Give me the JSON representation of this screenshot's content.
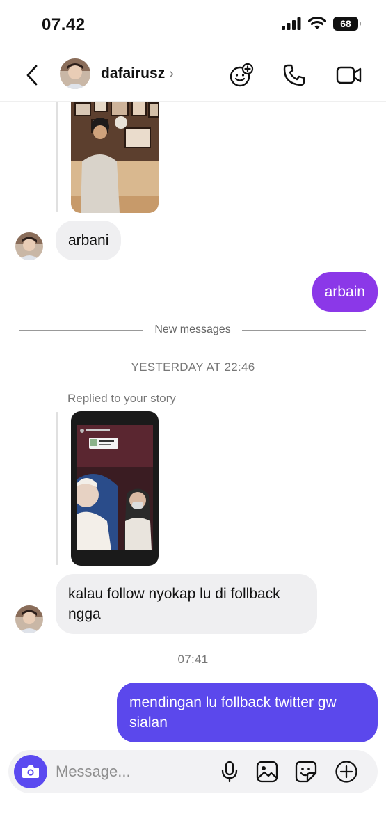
{
  "status_bar": {
    "time": "07.42",
    "battery": "68"
  },
  "header": {
    "username": "dafairusz",
    "chevron": "›"
  },
  "messages": {
    "m1": {
      "text": "arbani"
    },
    "m2": {
      "text": "arbain",
      "color": "#8b38e8"
    },
    "new_messages_label": "New messages",
    "timestamp1": "YESTERDAY AT 22:46",
    "replied_label": "Replied to your story",
    "m3": {
      "text_line1": "kalau follow nyokap lu di follback",
      "text_line2": "ngga"
    },
    "timestamp2": "07:41",
    "m4": {
      "text_line1": "mendingan lu follback twitter gw",
      "text_line2": "sialan",
      "color": "#5b48ec"
    }
  },
  "composer": {
    "placeholder": "Message..."
  },
  "icons": [
    "back-chevron-icon",
    "sticker-add-icon",
    "phone-icon",
    "video-icon",
    "camera-icon",
    "microphone-icon",
    "gallery-icon",
    "sticker-icon",
    "plus-circle-icon"
  ],
  "colors": {
    "accent": "#5b4af0",
    "bubble_in": "#efeff1"
  }
}
